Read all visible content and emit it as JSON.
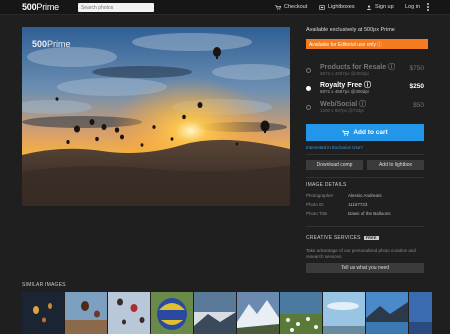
{
  "header": {
    "logo_main": "500",
    "logo_sub": "Prime",
    "search_placeholder": "Search photos",
    "nav": [
      {
        "label": "Checkout",
        "icon": "cart-icon"
      },
      {
        "label": "Lightboxes",
        "icon": "lightbox-icon"
      },
      {
        "label": "Sign up",
        "icon": "user-icon"
      },
      {
        "label": "Log in",
        "icon": ""
      }
    ],
    "menu_icon": "kebab-menu-icon"
  },
  "photo": {
    "watermark_main": "500",
    "watermark_sub": "Prime"
  },
  "panel": {
    "availability": "Available exclusively at 500px Prime",
    "editorial_notice": "Available for Editorial use only",
    "options": [
      {
        "name": "Products for Resale",
        "dims": "6872 x 4597px @300dpi",
        "price": "$750",
        "selected": false
      },
      {
        "name": "Royalty Free",
        "dims": "6872 x 4597px @300dpi",
        "price": "$250",
        "selected": true
      },
      {
        "name": "Web/Social",
        "dims": "1200 x 867px @72dpi",
        "price": "$50",
        "selected": false
      }
    ],
    "add_to_cart": "Add to cart",
    "exclusive_link": "Interested in Exclusive Use?",
    "download_comp": "Download comp",
    "add_to_lightbox": "Add to lightbox",
    "details_title": "IMAGE DETAILS",
    "details": [
      {
        "label": "Photographer",
        "value": "Alessio Andreani"
      },
      {
        "label": "Photo ID",
        "value": "11167723"
      },
      {
        "label": "Photo Title",
        "value": "Dawn of the Balloons"
      }
    ],
    "creative_title": "CREATIVE SERVICES",
    "creative_badge": "FREE",
    "creative_text": "Take advantage of our personalized photo curation and research services.",
    "tell_us": "Tell us what you need"
  },
  "similar": {
    "title": "SIMILAR IMAGES",
    "thumbs": [
      "balloons-night",
      "balloons-valley",
      "balloons-sky",
      "balloon-closeup",
      "mountain-clouds",
      "snow-peaks",
      "flower-field",
      "blue-sky",
      "mountain-lake",
      "blue-edge"
    ]
  },
  "colors": {
    "accent_blue": "#2296e8",
    "editorial_orange": "#f47b20",
    "background": "#1f1f1f"
  }
}
